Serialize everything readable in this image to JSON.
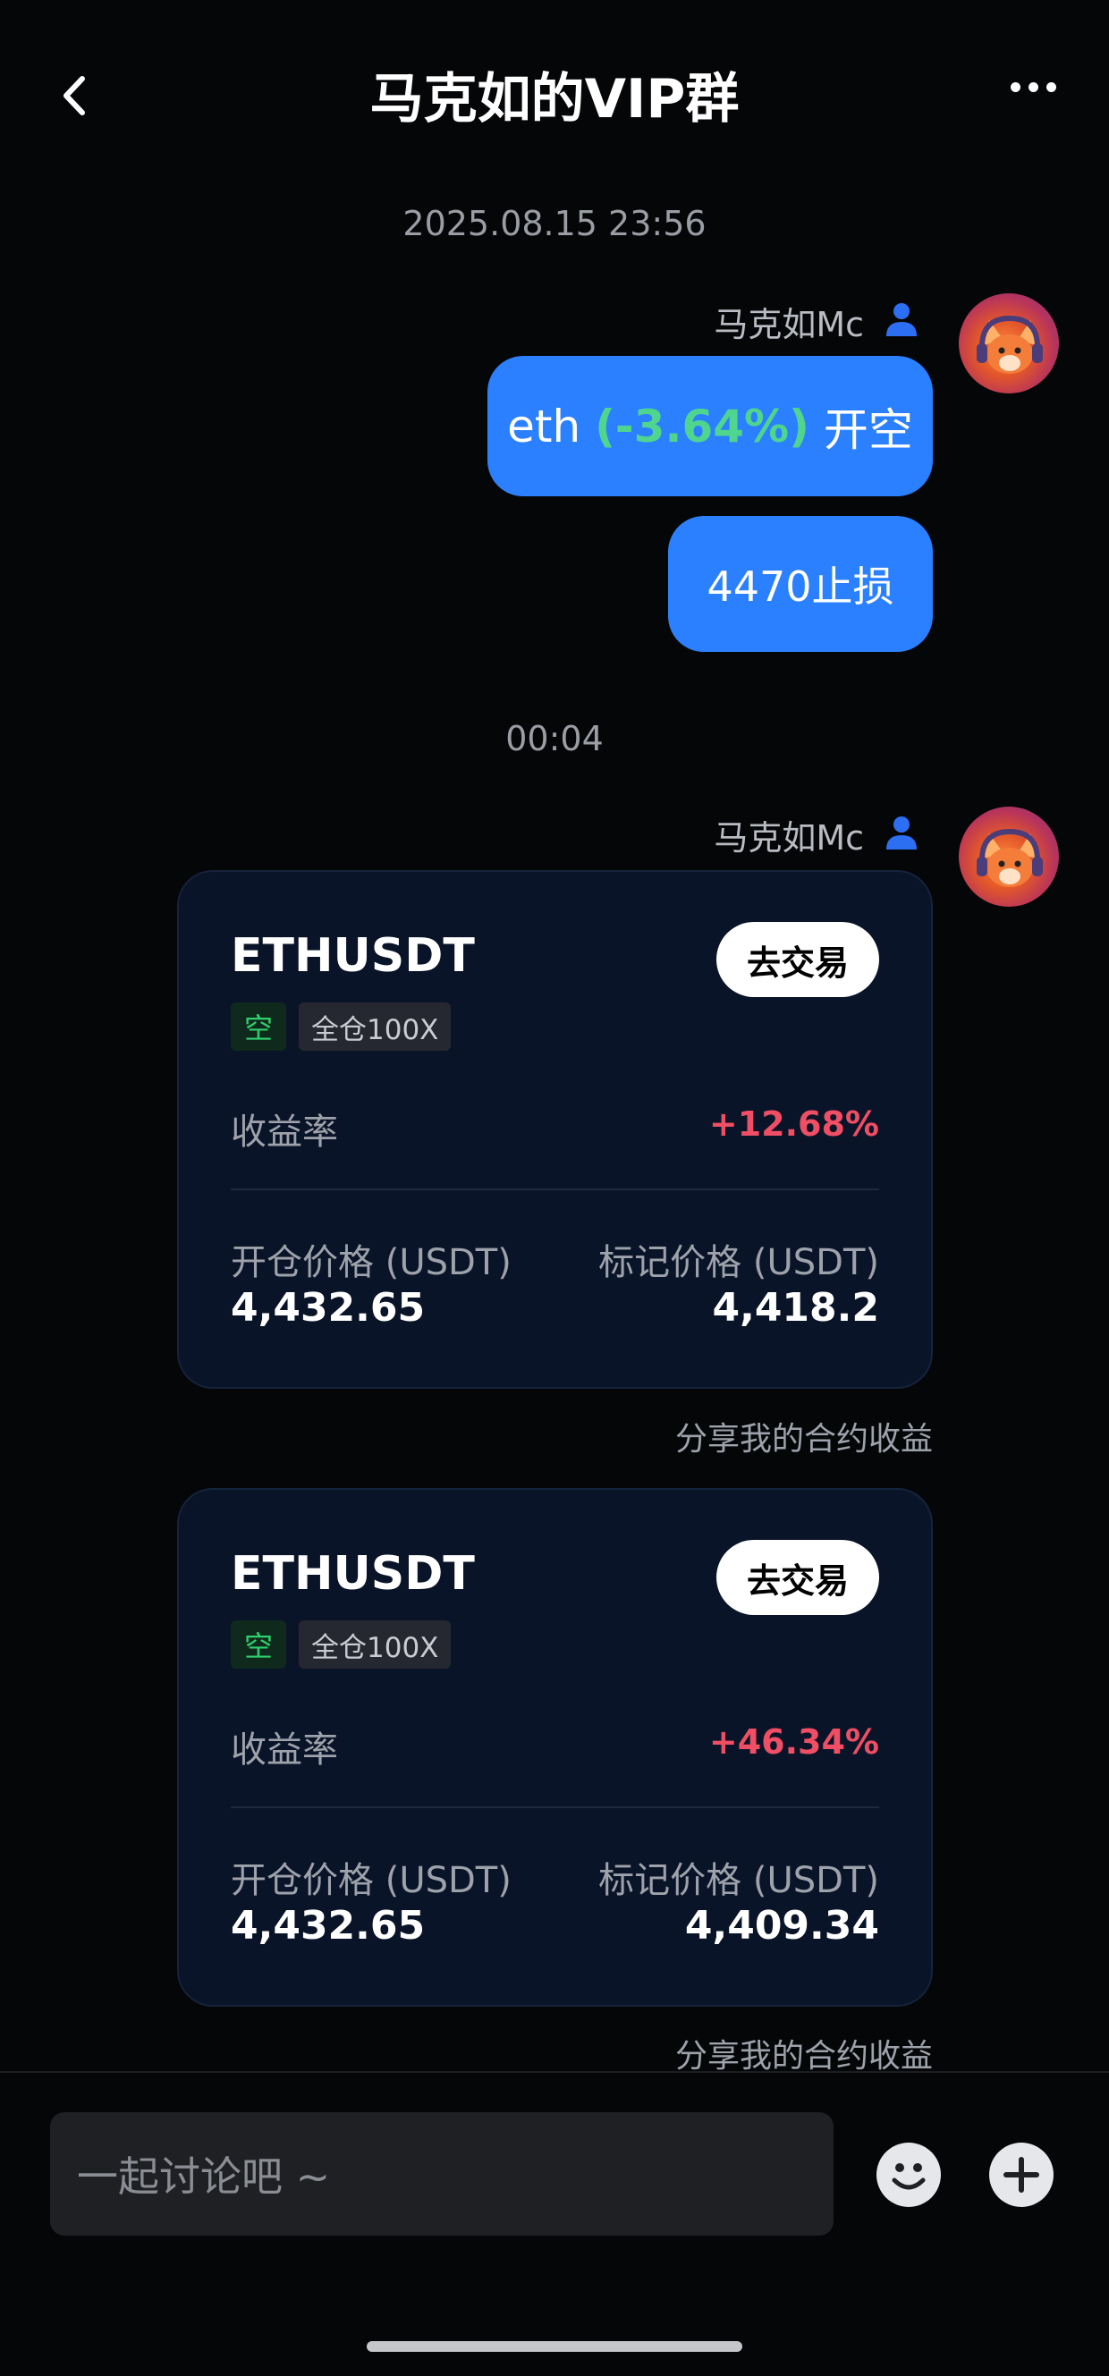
{
  "header": {
    "title": "马克如的VIP群"
  },
  "messages": {
    "group1_time": "2025.08.15 23:56",
    "sender1": "马克如Mc",
    "bubble1_prefix": "eth ",
    "bubble1_highlight": "(-3.64%)",
    "bubble1_suffix": " 开空",
    "bubble2": "4470止损",
    "group2_time": "00:04",
    "sender2": "马克如Mc"
  },
  "cards": [
    {
      "symbol": "ETHUSDT",
      "trade_button": "去交易",
      "direction_tag": "空",
      "leverage_tag": "全仓100X",
      "pnl_label": "收益率",
      "pnl_value": "+12.68%",
      "open_price_label": "开仓价格 (USDT)",
      "open_price": "4,432.65",
      "mark_price_label": "标记价格 (USDT)",
      "mark_price": "4,418.2",
      "share_text": "分享我的合约收益"
    },
    {
      "symbol": "ETHUSDT",
      "trade_button": "去交易",
      "direction_tag": "空",
      "leverage_tag": "全仓100X",
      "pnl_label": "收益率",
      "pnl_value": "+46.34%",
      "open_price_label": "开仓价格 (USDT)",
      "open_price": "4,432.65",
      "mark_price_label": "标记价格 (USDT)",
      "mark_price": "4,409.34",
      "share_text": "分享我的合约收益"
    }
  ],
  "input": {
    "placeholder": "一起讨论吧 ~"
  },
  "icons": {
    "back": "chevron-left-icon",
    "more": "more-horizontal-icon",
    "person": "person-icon",
    "emoji": "smile-icon",
    "plus": "plus-icon"
  },
  "colors": {
    "accent_blue": "#2b80ff",
    "profit_red": "#ef4e64",
    "pct_green": "#4fd58e",
    "card_bg": "#0a1428"
  }
}
